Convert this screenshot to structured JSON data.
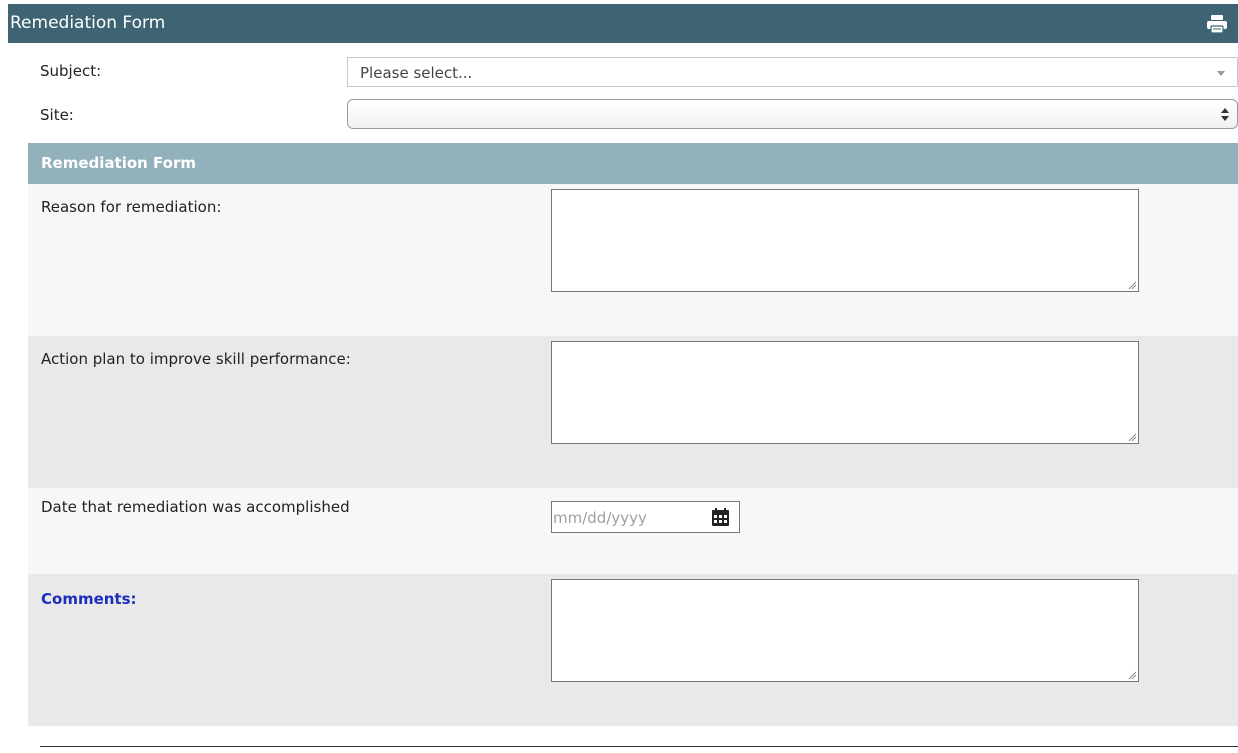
{
  "titlebar": {
    "title": "Remediation Form",
    "print_icon": "printer-icon"
  },
  "subject": {
    "label": "Subject:",
    "placeholder": "Please select..."
  },
  "site": {
    "label": "Site:",
    "value": ""
  },
  "section": {
    "title": "Remediation Form"
  },
  "fields": {
    "reason": {
      "label": "Reason for remediation:",
      "value": ""
    },
    "action_plan": {
      "label": "Action plan to improve skill performance:",
      "value": ""
    },
    "date": {
      "label": "Date that remediation was accomplished",
      "placeholder": "mm/dd/yyyy",
      "icon": "calendar-icon"
    },
    "comments": {
      "label": "Comments:",
      "value": ""
    }
  },
  "colors": {
    "titlebar": "#3e6474",
    "section_header": "#93b1ba",
    "band_light": "#f7f7f7",
    "band_grey": "#e9e9e9",
    "comments_label": "#1a2fbf"
  }
}
